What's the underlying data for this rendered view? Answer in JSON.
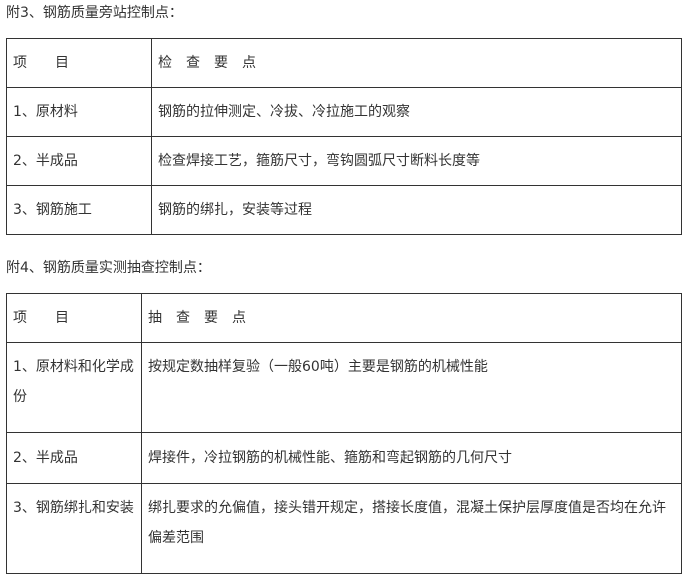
{
  "section3": {
    "title": "附3、钢筋质量旁站控制点：",
    "table": {
      "header": [
        "项　　目",
        "检　查　要　点"
      ],
      "rows": [
        [
          "1、原材料",
          "钢筋的拉伸测定、冷拔、冷拉施工的观察"
        ],
        [
          "2、半成品",
          "检查焊接工艺，箍筋尺寸，弯钩圆弧尺寸断料长度等"
        ],
        [
          "3、钢筋施工",
          "钢筋的绑扎，安装等过程"
        ]
      ]
    }
  },
  "section4": {
    "title": "附4、钢筋质量实测抽查控制点：",
    "table": {
      "header": [
        "项　　目",
        "抽　查　要　点"
      ],
      "rows": [
        [
          "1、原材料和化学成份",
          "按规定数抽样复验（一般60吨）主要是钢筋的机械性能"
        ],
        [
          "2、半成品",
          "焊接件，冷拉钢筋的机械性能、箍筋和弯起钢筋的几何尺寸"
        ],
        [
          "3、钢筋绑扎和安装",
          "绑扎要求的允偏值，接头错开规定，搭接长度值，混凝土保护层厚度值是否均在允许偏差范围"
        ]
      ]
    }
  }
}
